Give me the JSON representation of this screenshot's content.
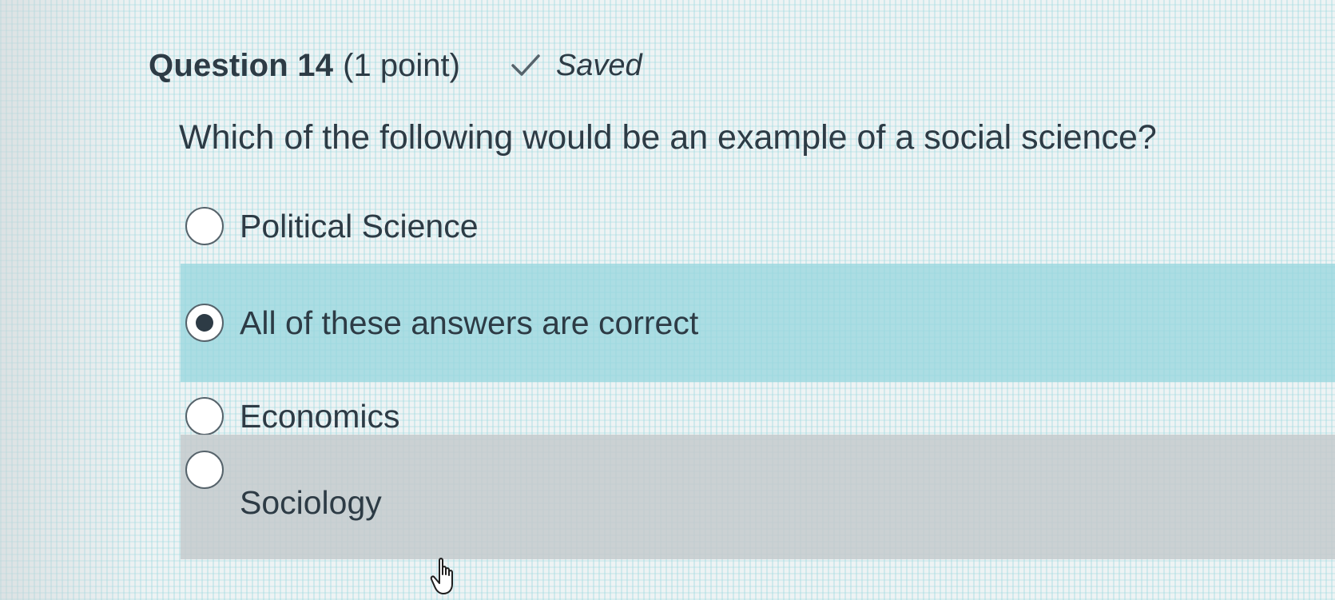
{
  "question": {
    "title": "Question 14",
    "points": "(1 point)",
    "status": "Saved",
    "status_icon": "check-icon",
    "text": "Which of the following would be an example of a social science?"
  },
  "answers": [
    {
      "label": "Political Science",
      "selected": false
    },
    {
      "label": "All of these answers are correct",
      "selected": true
    },
    {
      "label": "Economics",
      "selected": false
    },
    {
      "label": "Sociology",
      "selected": false,
      "hovered": true
    }
  ],
  "cursor": {
    "icon": "hand-pointer-icon"
  },
  "colors": {
    "text": "#2d3b45",
    "selected_background": "#96d6de",
    "hover_background": "#c4cacc"
  }
}
